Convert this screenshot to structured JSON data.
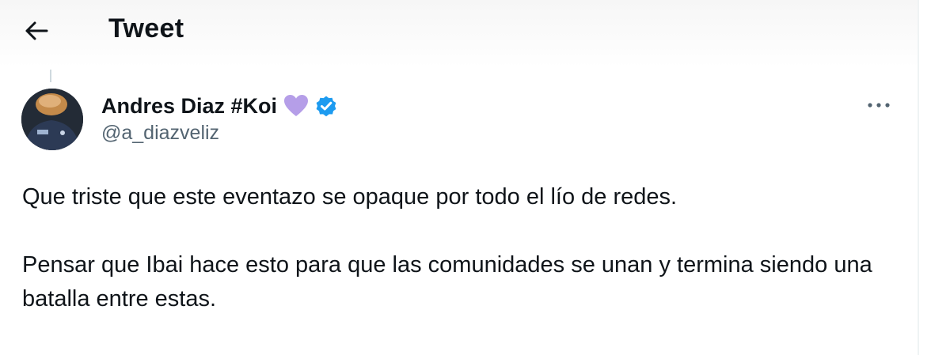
{
  "header": {
    "title": "Tweet",
    "back_icon": "arrow-left-icon"
  },
  "author": {
    "display_name": "Andres Diaz #Koi",
    "handle": "@a_diazveliz",
    "badge_emoji": "purple-heart-icon",
    "verified_icon": "verified-badge-icon",
    "avatar_icon": "profile-photo"
  },
  "more_options_icon": "more-horizontal-icon",
  "tweet": {
    "paragraphs": [
      "Que triste que este eventazo se opaque por todo el lío de redes.",
      "Pensar que Ibai hace esto para que las comunidades se unan y termina siendo una batalla entre estas."
    ]
  },
  "colors": {
    "text_primary": "#0f1419",
    "text_secondary": "#536471",
    "verified_blue": "#1d9bf0",
    "heart_purple": "#b59ee8"
  }
}
